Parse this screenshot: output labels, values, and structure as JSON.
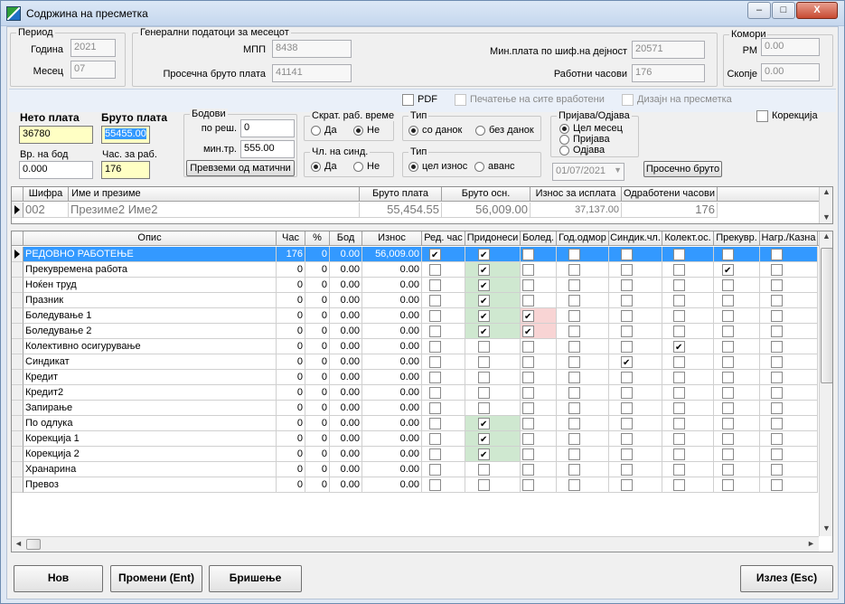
{
  "window": {
    "title": "Содржина на пресметка",
    "min": "–",
    "max": "□",
    "close": "X"
  },
  "period": {
    "title": "Период",
    "year_label": "Година",
    "year": "2021",
    "month_label": "Месец",
    "month": "07"
  },
  "general": {
    "title": "Генерални податоци за месецот",
    "mpp_label": "МПП",
    "mpp": "8438",
    "avg_label": "Просечна бруто плата",
    "avg": "41141",
    "min_label": "Мин.плата по шиф.на дејност",
    "min": "20571",
    "hours_label": "Работни часови",
    "hours": "176"
  },
  "chambers": {
    "title": "Комори",
    "rm_label": "РМ",
    "rm": "0.00",
    "sk_label": "Скопје",
    "sk": "0.00"
  },
  "options": {
    "pdf": "PDF",
    "print_all": "Печатење на сите вработени",
    "design": "Дизајн на пресметка"
  },
  "salary": {
    "net_label": "Нето плата",
    "net": "36780",
    "gross_label": "Бруто плата",
    "gross": "55455.00",
    "pointval_label": "Вр. на бод",
    "pointval": "0.000",
    "hourly_label": "Час. за раб.",
    "hourly": "176"
  },
  "points": {
    "title": "Бодови",
    "decision_label": "по реш.",
    "decision": "0",
    "mintr_label": "мин.тр.",
    "mintr": "555.00",
    "transfer_btn": "Превземи од матични"
  },
  "short_time": {
    "title": "Скрат. раб. време",
    "yes": "Да",
    "no": "Не",
    "selected": "Не"
  },
  "union_member": {
    "title": "Чл. на синд.",
    "yes": "Да",
    "no": "Не",
    "selected": "Да"
  },
  "type_tax": {
    "title": "Тип",
    "a": "со данок",
    "b": "без данок",
    "selected": "со данок"
  },
  "type_amount": {
    "title": "Тип",
    "a": "цел износ",
    "b": "аванс",
    "selected": "цел износ"
  },
  "registration": {
    "title": "Пријава/Одјава",
    "a": "Цел месец",
    "b": "Пријава",
    "c": "Одјава",
    "selected": "Цел месец",
    "date": "01/07/2021",
    "avg_gross_btn": "Просечно бруто"
  },
  "correction": {
    "label": "Корекција"
  },
  "employee_grid": {
    "columns": [
      "Шифра",
      "Име и презиме",
      "Бруто плата",
      "Бруто осн.",
      "Износ за исплата",
      "Одработени часови"
    ],
    "row": {
      "code": "002",
      "name": "Презиме2 Име2",
      "gross": "55,454.55",
      "base": "56,009.00",
      "payout": "37,137.00",
      "hours": "176"
    }
  },
  "items_grid": {
    "columns": [
      "Опис",
      "Час",
      "%",
      "Бод",
      "Износ",
      "Ред. час",
      "Придонеси",
      "Болед.",
      "Год.одмор",
      "Синдик.чл.",
      "Колект.ос.",
      "Прекувр.",
      "Нагр./Казна"
    ],
    "rows": [
      {
        "name": "РЕДОВНО РАБОТЕЊЕ",
        "hours": "176",
        "pct": "0",
        "pts": "0.00",
        "amt": "56,009.00",
        "flags": [
          1,
          1,
          0,
          0,
          0,
          0,
          0,
          0
        ]
      },
      {
        "name": "Прекувремена работа",
        "hours": "0",
        "pct": "0",
        "pts": "0.00",
        "amt": "0.00",
        "flags": [
          0,
          1,
          0,
          0,
          0,
          0,
          1,
          0
        ]
      },
      {
        "name": "Ноќен труд",
        "hours": "0",
        "pct": "0",
        "pts": "0.00",
        "amt": "0.00",
        "flags": [
          0,
          1,
          0,
          0,
          0,
          0,
          0,
          0
        ]
      },
      {
        "name": "Празник",
        "hours": "0",
        "pct": "0",
        "pts": "0.00",
        "amt": "0.00",
        "flags": [
          0,
          1,
          0,
          0,
          0,
          0,
          0,
          0
        ]
      },
      {
        "name": "Боледување 1",
        "hours": "0",
        "pct": "0",
        "pts": "0.00",
        "amt": "0.00",
        "flags": [
          0,
          1,
          1,
          0,
          0,
          0,
          0,
          0
        ]
      },
      {
        "name": "Боледување 2",
        "hours": "0",
        "pct": "0",
        "pts": "0.00",
        "amt": "0.00",
        "flags": [
          0,
          1,
          1,
          0,
          0,
          0,
          0,
          0
        ]
      },
      {
        "name": "Колективно осигурување",
        "hours": "0",
        "pct": "0",
        "pts": "0.00",
        "amt": "0.00",
        "flags": [
          0,
          0,
          0,
          0,
          0,
          1,
          0,
          0
        ]
      },
      {
        "name": "Синдикат",
        "hours": "0",
        "pct": "0",
        "pts": "0.00",
        "amt": "0.00",
        "flags": [
          0,
          0,
          0,
          0,
          1,
          0,
          0,
          0
        ]
      },
      {
        "name": "Кредит",
        "hours": "0",
        "pct": "0",
        "pts": "0.00",
        "amt": "0.00",
        "flags": [
          0,
          0,
          0,
          0,
          0,
          0,
          0,
          0
        ]
      },
      {
        "name": "Кредит2",
        "hours": "0",
        "pct": "0",
        "pts": "0.00",
        "amt": "0.00",
        "flags": [
          0,
          0,
          0,
          0,
          0,
          0,
          0,
          0
        ]
      },
      {
        "name": "Запирање",
        "hours": "0",
        "pct": "0",
        "pts": "0.00",
        "amt": "0.00",
        "flags": [
          0,
          0,
          0,
          0,
          0,
          0,
          0,
          0
        ]
      },
      {
        "name": "По одлука",
        "hours": "0",
        "pct": "0",
        "pts": "0.00",
        "amt": "0.00",
        "flags": [
          0,
          1,
          0,
          0,
          0,
          0,
          0,
          0
        ]
      },
      {
        "name": "Корекција 1",
        "hours": "0",
        "pct": "0",
        "pts": "0.00",
        "amt": "0.00",
        "flags": [
          0,
          1,
          0,
          0,
          0,
          0,
          0,
          0
        ]
      },
      {
        "name": "Корекција 2",
        "hours": "0",
        "pct": "0",
        "pts": "0.00",
        "amt": "0.00",
        "flags": [
          0,
          1,
          0,
          0,
          0,
          0,
          0,
          0
        ]
      },
      {
        "name": "Хранарина",
        "hours": "0",
        "pct": "0",
        "pts": "0.00",
        "amt": "0.00",
        "flags": [
          0,
          0,
          0,
          0,
          0,
          0,
          0,
          0
        ]
      },
      {
        "name": "Превоз",
        "hours": "0",
        "pct": "0",
        "pts": "0.00",
        "amt": "0.00",
        "flags": [
          0,
          0,
          0,
          0,
          0,
          0,
          0,
          0
        ]
      }
    ]
  },
  "buttons": {
    "new": "Нов",
    "edit": "Промени (Ent)",
    "delete": "Бришење",
    "exit": "Излез (Esc)"
  }
}
